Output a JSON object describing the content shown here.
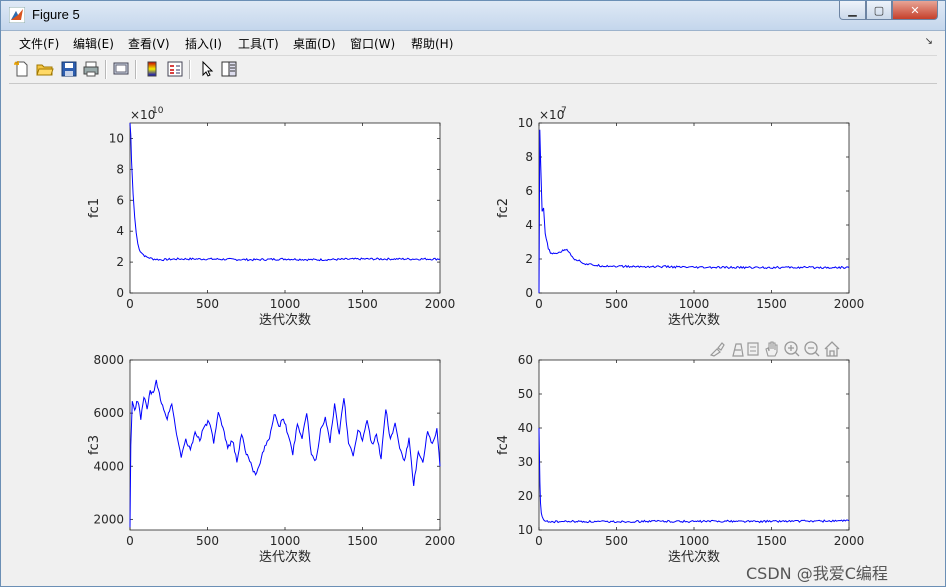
{
  "window": {
    "title": "Figure 5"
  },
  "menu": {
    "items": [
      {
        "label": "文件(F)"
      },
      {
        "label": "编辑(E)"
      },
      {
        "label": "查看(V)"
      },
      {
        "label": "插入(I)"
      },
      {
        "label": "工具(T)"
      },
      {
        "label": "桌面(D)"
      },
      {
        "label": "窗口(W)"
      },
      {
        "label": "帮助(H)"
      }
    ]
  },
  "toolbar": {
    "icons": [
      "new-figure-icon",
      "open-file-icon",
      "save-icon",
      "print-icon",
      "print-preview-icon",
      "colorbar-icon",
      "legend-icon",
      "select-arrow-icon",
      "property-editor-icon"
    ]
  },
  "plot_tools": {
    "icons": [
      "brush-icon",
      "data-cursor-icon",
      "link-icon",
      "pan-hand-icon",
      "zoom-in-icon",
      "zoom-out-icon",
      "home-icon"
    ]
  },
  "watermark": "CSDN @我爱C编程",
  "colors": {
    "line": "#0000ff",
    "axes_bg": "#ffffff",
    "figure_bg": "#f0f0f0"
  },
  "chart_data": [
    {
      "type": "line",
      "ylabel": "fc1",
      "xlabel": "迭代次数",
      "xlim": [
        0,
        2000
      ],
      "ylim": [
        0,
        11
      ],
      "xticks": [
        "0",
        "500",
        "1000",
        "1500",
        "2000"
      ],
      "yticks": [
        "0",
        "2",
        "4",
        "6",
        "8",
        "10"
      ],
      "exponent": "×10",
      "exponent_power": "10",
      "series": [
        {
          "x": [
            0,
            5,
            10,
            20,
            30,
            40,
            50,
            60,
            80,
            100,
            150,
            200,
            300,
            500,
            800,
            1000,
            1200,
            1500,
            1800,
            2000
          ],
          "y": [
            11.0,
            10.2,
            8.6,
            6.4,
            4.9,
            3.9,
            3.2,
            2.8,
            2.55,
            2.35,
            2.2,
            2.15,
            2.2,
            2.2,
            2.15,
            2.2,
            2.15,
            2.2,
            2.2,
            2.2
          ]
        }
      ]
    },
    {
      "type": "line",
      "ylabel": "fc2",
      "xlabel": "迭代次数",
      "xlim": [
        0,
        2000
      ],
      "ylim": [
        0,
        10
      ],
      "xticks": [
        "0",
        "500",
        "1000",
        "1500",
        "2000"
      ],
      "yticks": [
        "0",
        "2",
        "4",
        "6",
        "8",
        "10"
      ],
      "exponent": "×10",
      "exponent_power": "7",
      "series": [
        {
          "x": [
            0,
            5,
            10,
            20,
            30,
            40,
            60,
            80,
            100,
            130,
            160,
            180,
            200,
            230,
            260,
            300,
            400,
            600,
            800,
            1000,
            1200,
            1500,
            1800,
            2000
          ],
          "y": [
            0,
            9.6,
            8.0,
            4.8,
            5.0,
            3.5,
            2.6,
            2.3,
            2.3,
            2.4,
            2.5,
            2.6,
            2.3,
            2.0,
            1.9,
            1.7,
            1.6,
            1.55,
            1.55,
            1.5,
            1.5,
            1.5,
            1.5,
            1.5
          ]
        }
      ]
    },
    {
      "type": "line",
      "ylabel": "fc3",
      "xlabel": "迭代次数",
      "xlim": [
        0,
        2000
      ],
      "ylim": [
        1600,
        8000
      ],
      "xticks": [
        "0",
        "500",
        "1000",
        "1500",
        "2000"
      ],
      "yticks": [
        "2000",
        "4000",
        "6000",
        "8000"
      ],
      "series": [
        {
          "x": [
            0,
            5,
            15,
            30,
            50,
            70,
            90,
            110,
            130,
            150,
            170,
            190,
            210,
            240,
            270,
            300,
            330,
            360,
            390,
            420,
            450,
            480,
            510,
            540,
            570,
            600,
            630,
            660,
            690,
            720,
            750,
            780,
            810,
            840,
            870,
            900,
            930,
            960,
            990,
            1020,
            1050,
            1080,
            1110,
            1140,
            1170,
            1200,
            1230,
            1260,
            1290,
            1320,
            1350,
            1380,
            1410,
            1440,
            1470,
            1500,
            1530,
            1560,
            1590,
            1620,
            1650,
            1680,
            1710,
            1740,
            1770,
            1800,
            1830,
            1860,
            1890,
            1920,
            1950,
            1980,
            2000
          ],
          "y": [
            1700,
            4800,
            6400,
            6100,
            6500,
            5800,
            6600,
            6200,
            6800,
            6700,
            7200,
            6700,
            6300,
            5800,
            6400,
            5200,
            4400,
            5000,
            4600,
            5300,
            5000,
            5500,
            5700,
            4900,
            6000,
            5400,
            4700,
            5000,
            4200,
            5200,
            4500,
            4100,
            3600,
            4100,
            4800,
            5000,
            6000,
            5500,
            5800,
            5200,
            4500,
            5600,
            5100,
            6000,
            4400,
            4200,
            5400,
            5800,
            4900,
            6300,
            5200,
            6600,
            4900,
            4400,
            5400,
            5000,
            5800,
            4800,
            5200,
            4300,
            6200,
            5000,
            5600,
            4700,
            4200,
            5000,
            3300,
            4500,
            4100,
            5300,
            4800,
            5400,
            4000
          ]
        }
      ]
    },
    {
      "type": "line",
      "ylabel": "fc4",
      "xlabel": "迭代次数",
      "xlim": [
        0,
        2000
      ],
      "ylim": [
        10,
        60
      ],
      "xticks": [
        "0",
        "500",
        "1000",
        "1500",
        "2000"
      ],
      "yticks": [
        "10",
        "20",
        "30",
        "40",
        "50",
        "60"
      ],
      "series": [
        {
          "x": [
            0,
            3,
            6,
            10,
            15,
            20,
            30,
            40,
            60,
            100,
            200,
            400,
            600,
            800,
            1000,
            1200,
            1400,
            1600,
            1800,
            2000
          ],
          "y": [
            40,
            31,
            24,
            18,
            15,
            14,
            13,
            12.6,
            12.5,
            12.4,
            12.5,
            12.4,
            12.5,
            12.6,
            12.5,
            12.6,
            12.5,
            12.6,
            12.6,
            12.7
          ]
        }
      ]
    }
  ]
}
